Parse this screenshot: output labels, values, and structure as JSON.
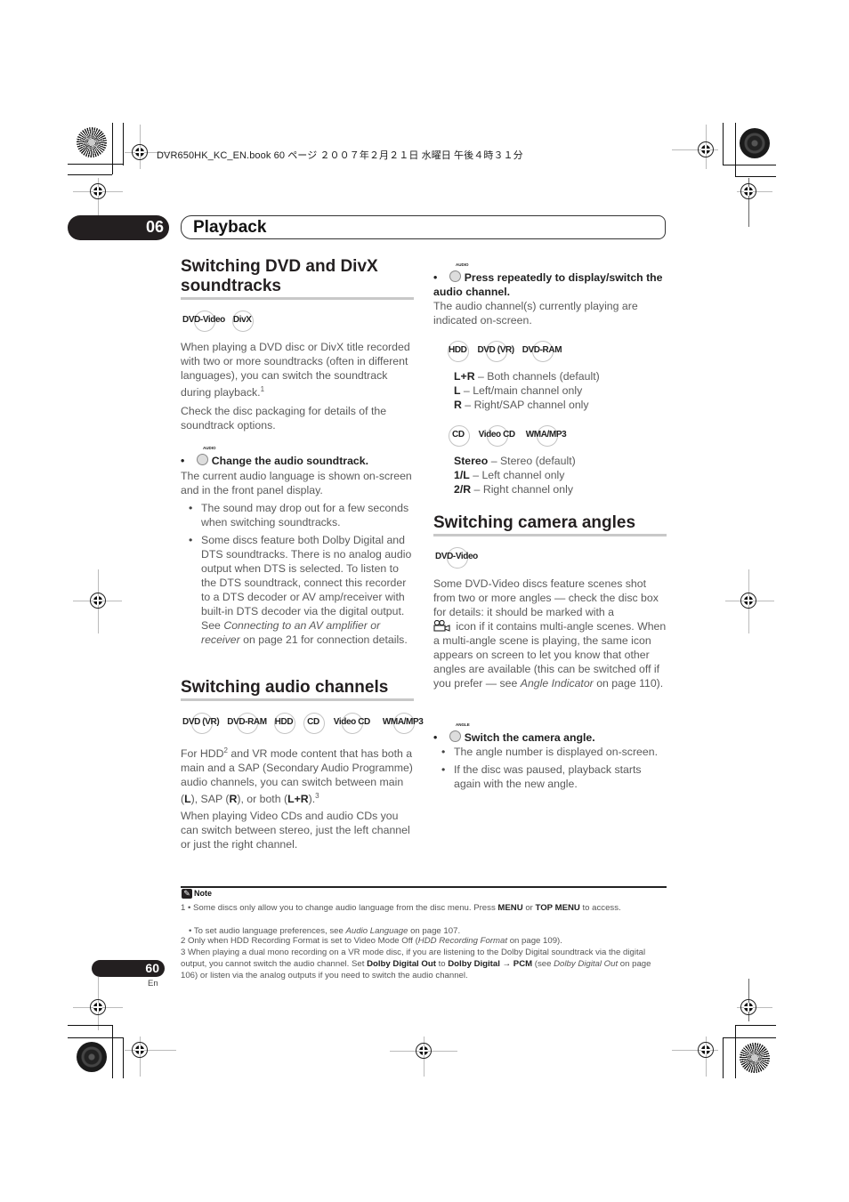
{
  "header": {
    "print_line": "DVR650HK_KC_EN.book  60 ページ  ２００７年２月２１日  水曜日  午後４時３１分"
  },
  "chapter": {
    "number": "06",
    "title": "Playback"
  },
  "left_column": {
    "section1": {
      "title_line1": "Switching DVD and DivX",
      "title_line2": "soundtracks",
      "badges": [
        "DVD-Video",
        "DivX"
      ],
      "paragraph1": "When playing a DVD disc or DivX title recorded with two or more soundtracks (often in different languages), you can switch the soundtrack during playback.",
      "paragraph1_footnote": "1",
      "paragraph2": "Check the disc packaging for details of the soundtrack options.",
      "command": {
        "button_label": "AUDIO",
        "text": "Change the audio soundtrack."
      },
      "command_desc": "The current audio language is shown on-screen and in the front panel display.",
      "bullets": [
        "The sound may drop out for a few seconds when switching soundtracks.",
        "Some discs feature both Dolby Digital and DTS soundtracks. There is no analog audio output when DTS is selected. To listen to the DTS soundtrack, connect this recorder to a DTS decoder or AV amp/receiver with built-in DTS decoder via the digital output. See"
      ],
      "bullet2_link": "Connecting to an AV amplifier or receiver",
      "bullet2_tail": " on page 21 for connection details."
    },
    "section2": {
      "title": "Switching audio channels",
      "badges": [
        "DVD (VR)",
        "DVD-RAM",
        "HDD",
        "CD",
        "Video CD",
        "WMA/MP3"
      ],
      "p1_a": "For HDD",
      "p1_fn": "2",
      "p1_b": " and VR mode content that has both a main and a SAP (Secondary Audio Programme) audio channels, you can switch between main (",
      "p1_L": "L",
      "p1_c": "), SAP (",
      "p1_R": "R",
      "p1_d": "), or both (",
      "p1_LR": "L+R",
      "p1_e": ").",
      "p1_fn2": "3",
      "paragraph2": "When playing Video CDs and audio CDs you can switch between stereo, just the left channel or just the right channel."
    }
  },
  "right_column": {
    "command": {
      "button_label": "AUDIO",
      "text": "Press repeatedly to display/switch the audio channel."
    },
    "command_desc": "The audio channel(s) currently playing are indicated on-screen.",
    "group1": {
      "badges": [
        "HDD",
        "DVD (VR)",
        "DVD-RAM"
      ],
      "options": [
        {
          "key": "L+R",
          "desc": " – Both channels (default)"
        },
        {
          "key": "L",
          "desc": " – Left/main channel only"
        },
        {
          "key": "R",
          "desc": " – Right/SAP channel only"
        }
      ]
    },
    "group2": {
      "badges": [
        "CD",
        "Video CD",
        "WMA/MP3"
      ],
      "options": [
        {
          "key": "Stereo",
          "desc": " – Stereo (default)"
        },
        {
          "key": "1/L",
          "desc": " – Left channel only"
        },
        {
          "key": "2/R",
          "desc": " – Right channel only"
        }
      ]
    },
    "section3": {
      "title": "Switching camera angles",
      "badges": [
        "DVD-Video"
      ],
      "p_a": "Some DVD-Video discs feature scenes shot from two or more angles — check the disc box for details: it should be marked with a",
      "p_b": " icon if it contains multi-angle scenes. When a multi-angle scene is playing, the same icon appears on screen to let you know that other angles are available (this can be switched off if you prefer — see ",
      "p_link": "Angle Indicator",
      "p_c": " on page 110).",
      "command": {
        "button_label": "ANGLE",
        "text": "Switch the camera angle."
      },
      "bullets": [
        "The angle number is displayed on-screen.",
        "If the disc was paused, playback starts again with the new angle."
      ]
    }
  },
  "notes": {
    "title": "Note",
    "fn1_num": "1",
    "fn1_a": " • Some discs only allow you to change audio language from the disc menu. Press ",
    "fn1_menu": "MENU",
    "fn1_or": " or ",
    "fn1_top": "TOP MENU",
    "fn1_b": " to access.",
    "fn1_c_a": "• To set audio language preferences, see ",
    "fn1_c_link": "Audio Language",
    "fn1_c_b": " on page 107.",
    "fn2_a": "2 Only when HDD Recording Format is set to Video Mode Off (",
    "fn2_link": "HDD Recording Format",
    "fn2_b": " on page 109).",
    "fn3_a": "3 When playing a dual mono recording on a VR mode disc, if you are listening to the Dolby Digital soundtrack via the digital output, you cannot switch the audio channel. Set ",
    "fn3_b1": "Dolby Digital Out",
    "fn3_to": " to ",
    "fn3_b2": "Dolby Digital → PCM",
    "fn3_c": " (see ",
    "fn3_link": "Dolby Digital Out",
    "fn3_d": " on page 106) or listen via the analog outputs if you need to switch the audio channel."
  },
  "footer": {
    "page_number": "60",
    "language": "En"
  }
}
